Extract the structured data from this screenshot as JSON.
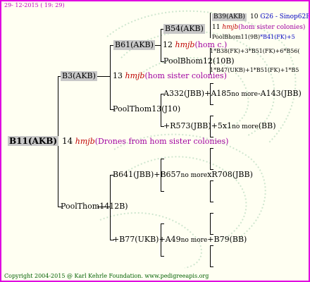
{
  "header": {
    "date": "29- 12-2015 ( 19: 29)"
  },
  "root": {
    "id": "B11(AKB)",
    "count": "14",
    "source": "hmjb",
    "note": "(Drones from hom sister colonies)"
  },
  "g1": {
    "mother": "B3(AKB)",
    "father": "PoolThom1412B)",
    "mother_count": "13",
    "mother_source": "hmjb",
    "mother_note": "(hom sister colonies)"
  },
  "g2": {
    "b61": "B61(AKB)",
    "b61_count": "12",
    "b61_source": "hmjb",
    "b61_note": "(hom c.)",
    "poolthom13": "PoolThom13(J10)",
    "b641_a": "B641(JBB)+B657",
    "b641_b": "xR708(JBB)",
    "b77_a": "+B77(UKB)+A49",
    "b77_b": "+B79(BB)",
    "nomore": "no more"
  },
  "g3": {
    "b54": "B54(AKB)",
    "poolbhom12": "PoolBhom12(10B)",
    "a332_a": "A332(JBB)+A185",
    "a332_b": "-A143(JBB)",
    "r573_a": "+R573(JBB)+5x1",
    "r573_b": "(BB)"
  },
  "g4": {
    "b39": "B39(AKB)",
    "b39_count": "10",
    "g26": "G26 - Sinop62R",
    "b54_count": "11",
    "b54_source": "hmjb",
    "b54_note": "(hom sister colonies)",
    "poolbhom11": "PoolBhom11(9B)",
    "poolbhom11_extra": "*B41(FK)+5",
    "b38": "1*B38(FK)+3*B51(FK)+6*B56(",
    "b47": "1*B47(UKB)+1*B51(FK)+1*B5"
  },
  "footer": {
    "copyright": "Copyright 2004-2015 @ Karl Kehrle Foundation.   www.pedigreeapis.org"
  }
}
